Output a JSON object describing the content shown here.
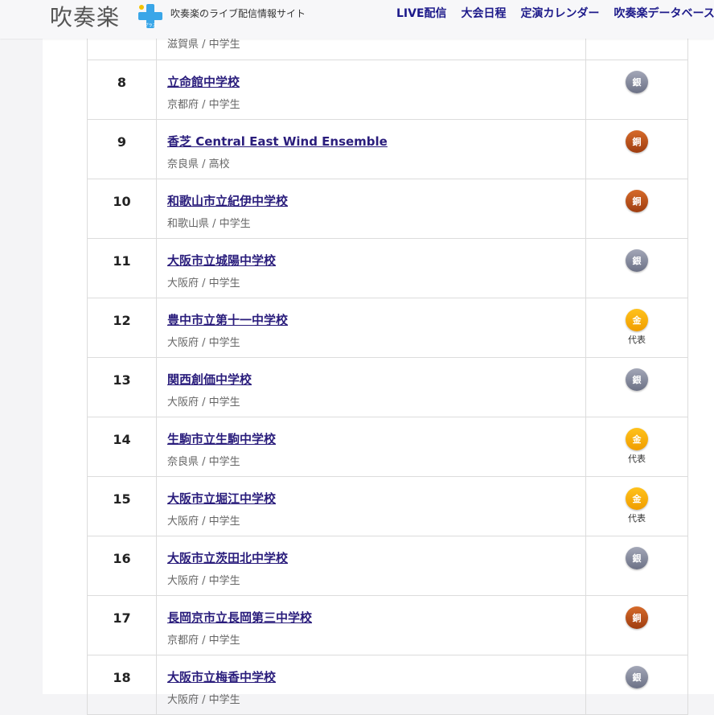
{
  "header": {
    "logo_text": "吹奏楽",
    "logo_plus_small": "プラス",
    "tagline": "吹奏楽のライブ配信情報サイト",
    "nav": [
      "LIVE配信",
      "大会日程",
      "定演カレンダー",
      "吹奏楽データベース"
    ]
  },
  "colors": {
    "link": "#2a1d7c",
    "silver": "#7a7f93",
    "bronze": "#b8501b",
    "gold": "#f5ad0a"
  },
  "rows": [
    {
      "rank": "",
      "school": "",
      "meta": "滋賀県 / 中学生",
      "award": "",
      "award_type": "none",
      "rep": ""
    },
    {
      "rank": "8",
      "school": "立命館中学校",
      "meta": "京都府 / 中学生",
      "award": "銀",
      "award_type": "silver",
      "rep": ""
    },
    {
      "rank": "9",
      "school": "香芝 Central East Wind Ensemble",
      "meta": "奈良県 / 高校",
      "award": "銅",
      "award_type": "bronze",
      "rep": ""
    },
    {
      "rank": "10",
      "school": "和歌山市立紀伊中学校",
      "meta": "和歌山県 / 中学生",
      "award": "銅",
      "award_type": "bronze",
      "rep": ""
    },
    {
      "rank": "11",
      "school": "大阪市立城陽中学校",
      "meta": "大阪府 / 中学生",
      "award": "銀",
      "award_type": "silver",
      "rep": ""
    },
    {
      "rank": "12",
      "school": "豊中市立第十一中学校",
      "meta": "大阪府 / 中学生",
      "award": "金",
      "award_type": "gold",
      "rep": "代表"
    },
    {
      "rank": "13",
      "school": "関西創価中学校",
      "meta": "大阪府 / 中学生",
      "award": "銀",
      "award_type": "silver",
      "rep": ""
    },
    {
      "rank": "14",
      "school": "生駒市立生駒中学校",
      "meta": "奈良県 / 中学生",
      "award": "金",
      "award_type": "gold",
      "rep": "代表"
    },
    {
      "rank": "15",
      "school": "大阪市立堀江中学校",
      "meta": "大阪府 / 中学生",
      "award": "金",
      "award_type": "gold",
      "rep": "代表"
    },
    {
      "rank": "16",
      "school": "大阪市立茨田北中学校",
      "meta": "大阪府 / 中学生",
      "award": "銀",
      "award_type": "silver",
      "rep": ""
    },
    {
      "rank": "17",
      "school": "長岡京市立長岡第三中学校",
      "meta": "京都府 / 中学生",
      "award": "銅",
      "award_type": "bronze",
      "rep": ""
    },
    {
      "rank": "18",
      "school": "大阪市立梅香中学校",
      "meta": "大阪府 / 中学生",
      "award": "銀",
      "award_type": "silver",
      "rep": ""
    }
  ]
}
